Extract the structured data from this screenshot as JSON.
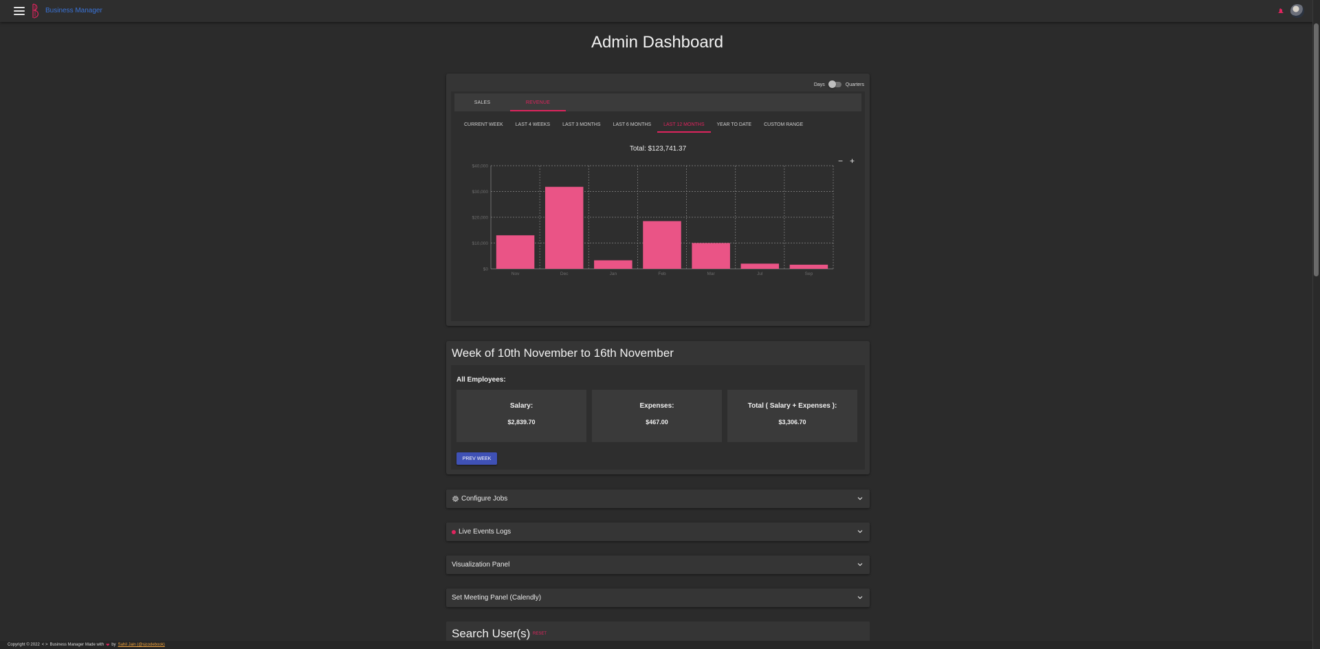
{
  "header": {
    "brand_name": "Business Manager",
    "menu_icon": "hamburger-menu-icon",
    "logo_icon": "b-logo-icon",
    "notification_icon": "notification-icon",
    "avatar": "user-avatar"
  },
  "page_title": "Admin Dashboard",
  "revenue_card": {
    "toggle_left": "Days",
    "toggle_right": "Quarters",
    "tabs": [
      "SALES",
      "REVENUE"
    ],
    "active_tab": "REVENUE",
    "ranges": [
      "CURRENT WEEK",
      "LAST 4 WEEKS",
      "LAST 3 MONTHS",
      "LAST 6 MONTHS",
      "LAST 12 MONTHS",
      "YEAR TO DATE",
      "CUSTOM RANGE"
    ],
    "active_range": "LAST 12 MONTHS",
    "total": "Total: $123,741.37",
    "zoom_out": "−",
    "zoom_in": "+"
  },
  "chart_data": {
    "type": "bar",
    "categories": [
      "Nov",
      "Dec",
      "Jan",
      "Feb",
      "Mar",
      "Jul",
      "Sep"
    ],
    "values": [
      13000,
      31800,
      3300,
      18500,
      10000,
      2000,
      1600
    ],
    "ylim": [
      0,
      40000
    ],
    "yticks": [
      "$0",
      "$10,000",
      "$20,000",
      "$30,000",
      "$40,000"
    ],
    "grid": true,
    "bar_color": "#ea5486"
  },
  "week_card": {
    "title": "Week of 10th November to 16th November",
    "subtitle": "All Employees:",
    "stats": [
      {
        "label": "Salary:",
        "value": "$2,839.70"
      },
      {
        "label": "Expenses:",
        "value": "$467.00"
      },
      {
        "label": "Total ( Salary + Expenses ):",
        "value": "$3,306.70"
      }
    ],
    "prev_button": "PREV WEEK"
  },
  "accordions": [
    {
      "label": "Configure Jobs",
      "icon": "gear-icon"
    },
    {
      "label": "Live Events Logs",
      "icon": "live-dot-icon"
    },
    {
      "label": "Visualization Panel"
    },
    {
      "label": "Set Meeting Panel (Calendly)"
    }
  ],
  "search": {
    "title": "Search User(s)",
    "reset": "RESET"
  },
  "footer": {
    "copyright": "Copyright © 2022",
    "code_glyph": "< >",
    "made_with": "Business Manager Made with",
    "by": "by",
    "author": "Sahil Jain (@sjcodebook)"
  },
  "colors": {
    "accent": "#e0245e",
    "brand_blue": "#3a74d9",
    "button_blue": "#3f51b5",
    "bar": "#ea5486"
  }
}
